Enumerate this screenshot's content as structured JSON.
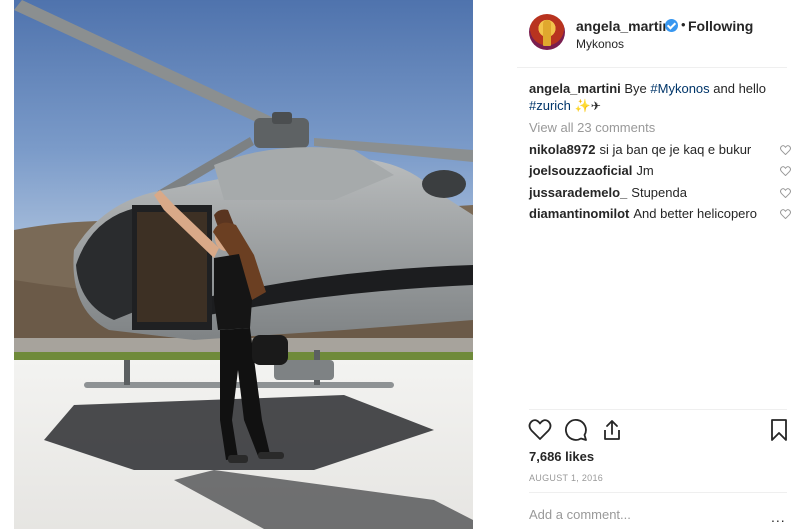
{
  "post": {
    "username": "angela_martini",
    "separator": "•",
    "follow_status": "Following",
    "location": "Mykonos",
    "caption": {
      "username": "angela_martini",
      "text_1": "Bye ",
      "hashtag_1": "#Mykonos",
      "text_2": " and hello",
      "hashtag_2": "#zurich",
      "emoji_sparkle": "✨",
      "emoji_plane": "✈"
    },
    "view_all_comments": "View all 23 comments",
    "comments": [
      {
        "username": "nikola8972",
        "text": "si ja ban qe je kaq e bukur"
      },
      {
        "username": "joelsouzzaoficial",
        "text": "Jm"
      },
      {
        "username": "jussarademelo_",
        "text": "Stupenda"
      },
      {
        "username": "diamantinomilot",
        "text": "And better helicopero"
      }
    ],
    "likes": "7,686 likes",
    "date": "AUGUST 1, 2016",
    "add_comment_placeholder": "Add a comment...",
    "more_options": "..."
  },
  "icons": {
    "verified": "verified-badge-icon",
    "like": "heart-icon",
    "comment": "comment-icon",
    "share": "share-icon",
    "save": "bookmark-icon"
  },
  "colors": {
    "sky": "#5b7fb6",
    "helicopter": "#9a9ea0",
    "verified_blue": "#3897f0",
    "hashtag": "#003569",
    "muted_text": "#999999"
  }
}
